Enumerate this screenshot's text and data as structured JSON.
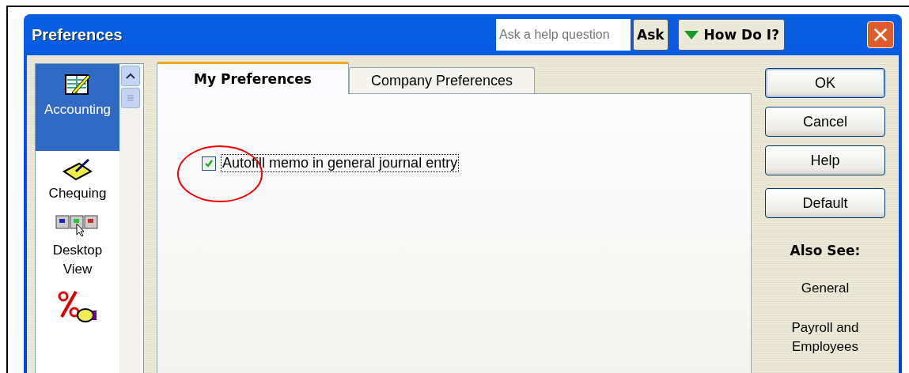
{
  "window": {
    "title": "Preferences"
  },
  "help": {
    "placeholder": "Ask a help question",
    "ask": "Ask",
    "how_do_i": "How Do I?"
  },
  "sidebar": {
    "items": [
      {
        "label": "Accounting",
        "kind": "ledger",
        "selected": true
      },
      {
        "label": "Chequing",
        "kind": "cheque",
        "selected": false
      },
      {
        "label": "Desktop View",
        "kind": "windows",
        "selected": false
      },
      {
        "kind": "percent",
        "selected": false
      }
    ]
  },
  "tabs": [
    {
      "label": "My Preferences",
      "selected": true
    },
    {
      "label": "Company Preferences",
      "selected": false
    }
  ],
  "options": [
    {
      "label": "Autofill memo in general journal entry",
      "checked": true
    }
  ],
  "buttons": [
    "OK",
    "Cancel",
    "Help",
    "Default"
  ],
  "also_see": {
    "title": "Also See:",
    "links": [
      "General",
      "Payroll and Employees"
    ]
  }
}
